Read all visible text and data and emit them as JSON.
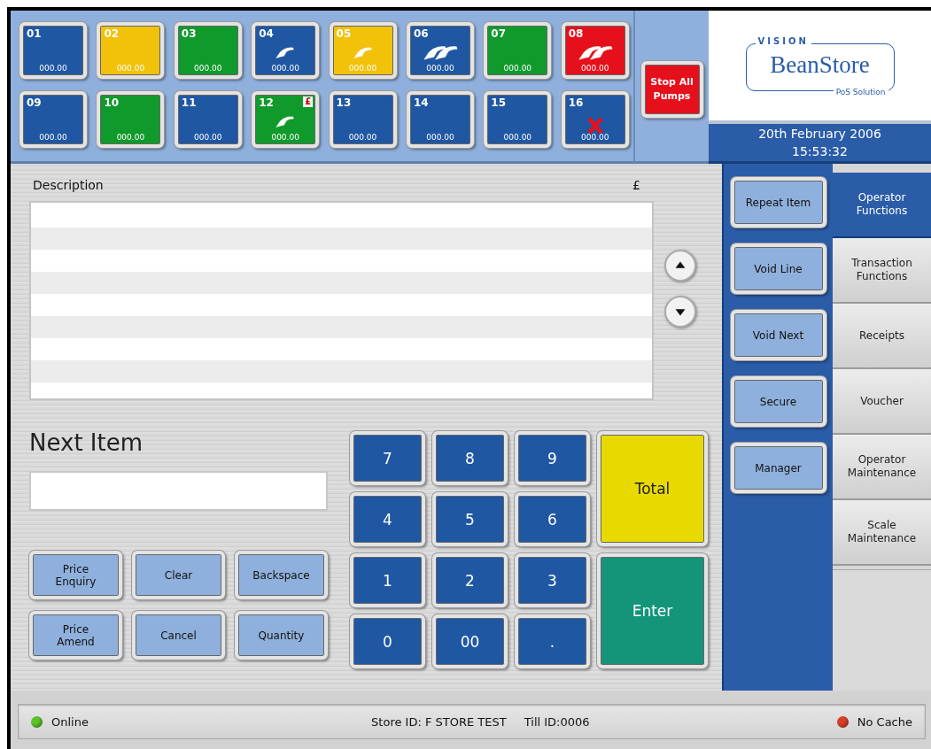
{
  "pumps": [
    {
      "number": "01",
      "amount": "000.00",
      "color": "#1f57a3",
      "kind": "idle",
      "stopped": false
    },
    {
      "number": "02",
      "amount": "000.00",
      "color": "#f2c10a",
      "kind": "idle",
      "stopped": false
    },
    {
      "number": "03",
      "amount": "000.00",
      "color": "#109a2c",
      "kind": "idle",
      "stopped": false
    },
    {
      "number": "04",
      "amount": "000.00",
      "color": "#1f57a3",
      "kind": "nozzle",
      "stopped": false
    },
    {
      "number": "05",
      "amount": "000.00",
      "color": "#f2c10a",
      "kind": "nozzle",
      "stopped": false
    },
    {
      "number": "06",
      "amount": "000.00",
      "color": "#1f57a3",
      "kind": "nozzles",
      "stopped": false
    },
    {
      "number": "07",
      "amount": "000.00",
      "color": "#109a2c",
      "kind": "idle",
      "stopped": false
    },
    {
      "number": "08",
      "amount": "000.00",
      "color": "#e5101b",
      "kind": "nozzles",
      "stopped": false
    },
    {
      "number": "09",
      "amount": "000.00",
      "color": "#1f57a3",
      "kind": "idle",
      "stopped": false
    },
    {
      "number": "10",
      "amount": "000.00",
      "color": "#109a2c",
      "kind": "idle",
      "stopped": false
    },
    {
      "number": "11",
      "amount": "000.00",
      "color": "#1f57a3",
      "kind": "idle",
      "stopped": false
    },
    {
      "number": "12",
      "amount": "000.00",
      "color": "#109a2c",
      "kind": "nozzle",
      "stopped": false,
      "badge": "£"
    },
    {
      "number": "13",
      "amount": "000.00",
      "color": "#1f57a3",
      "kind": "idle",
      "stopped": false
    },
    {
      "number": "14",
      "amount": "000.00",
      "color": "#1f57a3",
      "kind": "idle",
      "stopped": false
    },
    {
      "number": "15",
      "amount": "000.00",
      "color": "#1f57a3",
      "kind": "idle",
      "stopped": false
    },
    {
      "number": "16",
      "amount": "000.00",
      "color": "#1f57a3",
      "kind": "idle",
      "stopped": true
    }
  ],
  "stop_button": "Stop All Pumps",
  "logo": {
    "brand_top": "VISION",
    "name": "BeanStore",
    "tagline": "PoS Solution"
  },
  "date": "20th February 2006",
  "time": "15:53:32",
  "sale_list": {
    "columns": [
      "Description",
      "£"
    ]
  },
  "next_item": {
    "label": "Next Item"
  },
  "function_buttons": [
    "Price Enquiry",
    "Clear",
    "Backspace",
    "Price Amend",
    "Cancel",
    "Quantity"
  ],
  "keypad": [
    "7",
    "8",
    "9",
    "4",
    "5",
    "6",
    "1",
    "2",
    "3",
    "0",
    "00",
    "."
  ],
  "total_button": "Total",
  "enter_button": "Enter",
  "side_buttons": [
    "Repeat Item",
    "Void Line",
    "Void Next",
    "Secure",
    "Manager"
  ],
  "tabs": [
    {
      "label": "Operator Functions",
      "selected": true
    },
    {
      "label": "Transaction Functions",
      "selected": false
    },
    {
      "label": "Receipts",
      "selected": false
    },
    {
      "label": "Voucher",
      "selected": false
    },
    {
      "label": "Operator Maintenance",
      "selected": false
    },
    {
      "label": "Scale Maintenance",
      "selected": false
    }
  ],
  "status_bar": {
    "left": {
      "label": "Online",
      "color": "#5cc22a"
    },
    "store_id": "Store ID: F STORE TEST",
    "till_id": "Till ID:0006",
    "right": {
      "label": "No Cache",
      "color": "#d8402a"
    }
  }
}
